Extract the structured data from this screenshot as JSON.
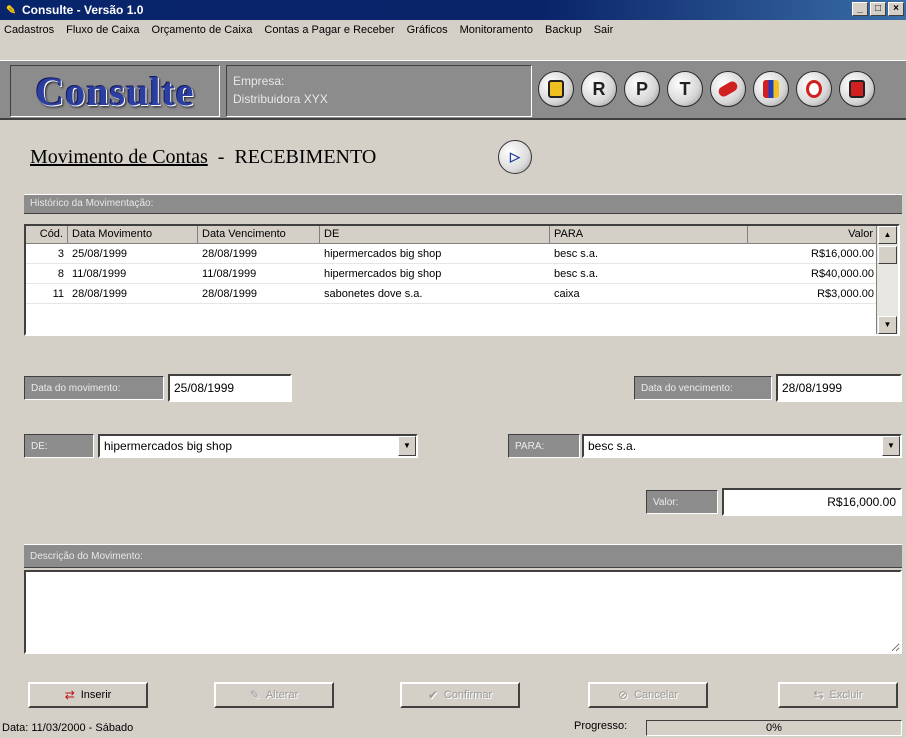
{
  "window": {
    "title": "Consulte - Versão 1.0",
    "controls": [
      "_",
      "□",
      "×"
    ]
  },
  "menubar": {
    "items": [
      "Cadastros",
      "Fluxo de Caixa",
      "Orçamento de Caixa",
      "Contas a Pagar e Receber",
      "Gráficos",
      "Monitoramento",
      "Backup",
      "Sair"
    ]
  },
  "brand": {
    "logo": "Consulte",
    "company_label": "Empresa:",
    "company_name": "Distribuidora XYX"
  },
  "toolbar": {
    "buttons": [
      "",
      "R",
      "P",
      "T",
      "",
      "",
      "",
      ""
    ]
  },
  "page": {
    "title_link": "Movimento de Contas",
    "separator": "-",
    "title_mode": "RECEBIMENTO"
  },
  "history": {
    "header": "Histórico da Movimentação:",
    "columns": [
      "Cód.",
      "Data Movimento",
      "Data Vencimento",
      "DE",
      "PARA",
      "Valor"
    ],
    "rows": [
      [
        "3",
        "25/08/1999",
        "28/08/1999",
        "hipermercados big shop",
        "besc s.a.",
        "R$16,000.00"
      ],
      [
        "8",
        "11/08/1999",
        "11/08/1999",
        "hipermercados big shop",
        "besc s.a.",
        "R$40,000.00"
      ],
      [
        "11",
        "28/08/1999",
        "28/08/1999",
        "sabonetes dove s.a.",
        "caixa",
        "R$3,000.00"
      ]
    ]
  },
  "form": {
    "data_movimento_label": "Data do movimento:",
    "data_movimento_value": "25/08/1999",
    "data_vencimento_label": "Data do vencimento:",
    "data_vencimento_value": "28/08/1999",
    "de_label": "DE:",
    "de_value": "hipermercados big shop",
    "para_label": "PARA:",
    "para_value": "besc s.a.",
    "valor_label": "Valor:",
    "valor_value": "R$16,000.00"
  },
  "description": {
    "header": "Descrição do Movimento:"
  },
  "actions": {
    "inserir": "Inserir",
    "alterar": "Alterar",
    "confirmar": "Confirmar",
    "cancelar": "Cancelar",
    "excluir": "Excluir"
  },
  "status": {
    "date_text": "Data: 11/03/2000  -  Sábado",
    "progress_label": "Progresso:",
    "progress_value": "0%"
  }
}
